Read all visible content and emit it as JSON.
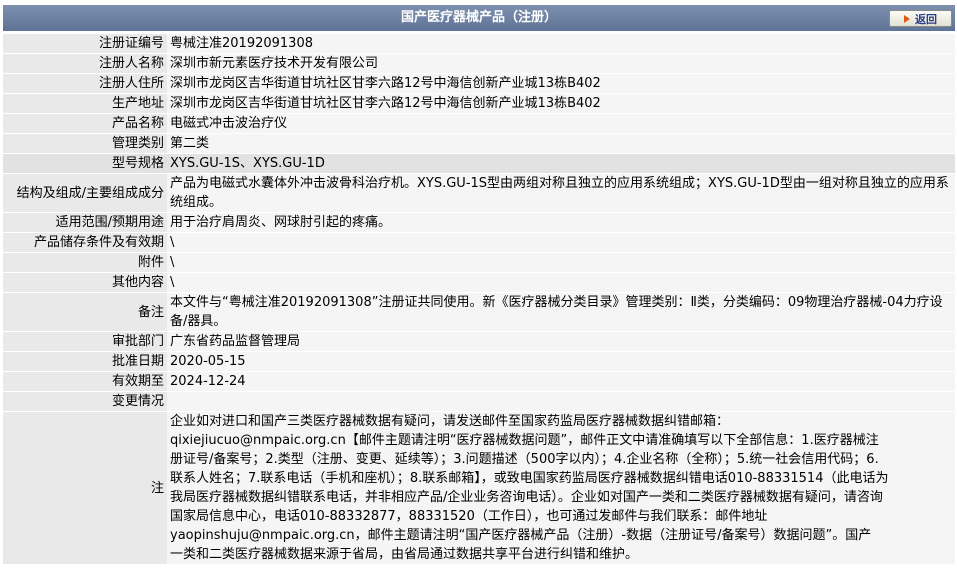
{
  "header": {
    "title": "国产医疗器械产品（注册）",
    "back_label": "返回"
  },
  "rows": [
    {
      "label": "注册证编号",
      "value": "粤械注准20192091308"
    },
    {
      "label": "注册人名称",
      "value": "深圳市新元素医疗技术开发有限公司"
    },
    {
      "label": "注册人住所",
      "value": "深圳市龙岗区吉华街道甘坑社区甘李六路12号中海信创新产业城13栋B402"
    },
    {
      "label": "生产地址",
      "value": "深圳市龙岗区吉华街道甘坑社区甘李六路12号中海信创新产业城13栋B402"
    },
    {
      "label": "产品名称",
      "value": "电磁式冲击波治疗仪"
    },
    {
      "label": "管理类别",
      "value": "第二类"
    },
    {
      "label": "型号规格",
      "value": "XYS.GU-1S、XYS.GU-1D"
    },
    {
      "label": "结构及组成/主要组成成分",
      "value": "产品为电磁式水囊体外冲击波骨科治疗机。XYS.GU-1S型由两组对称且独立的应用系统组成；XYS.GU-1D型由一组对称且独立的应用系统组成。"
    },
    {
      "label": "适用范围/预期用途",
      "value": "用于治疗肩周炎、网球肘引起的疼痛。"
    },
    {
      "label": "产品储存条件及有效期",
      "value": "\\"
    },
    {
      "label": "附件",
      "value": "\\"
    },
    {
      "label": "其他内容",
      "value": "\\"
    },
    {
      "label": "备注",
      "value": "本文件与“粤械注准20192091308”注册证共同使用。新《医疗器械分类目录》管理类别：Ⅱ类，分类编码：09物理治疗器械-04力疗设备/器具。"
    },
    {
      "label": "审批部门",
      "value": "广东省药品监督管理局"
    },
    {
      "label": "批准日期",
      "value": "2020-05-15"
    },
    {
      "label": "有效期至",
      "value": "2024-12-24"
    },
    {
      "label": "变更情况",
      "value": ""
    }
  ],
  "note": {
    "label": "注",
    "lines": [
      "企业如对进口和国产三类医疗器械数据有疑问，请发送邮件至国家药监局医疗器械数据纠错邮箱：",
      "qixiejiucuo@nmpaic.org.cn【邮件主题请注明“医疗器械数据问题”，邮件正文中请准确填写以下全部信息：1.医疗器械注",
      "册证号/备案号；2.类型（注册、变更、延续等）；3.问题描述（500字以内）；4.企业名称（全称）；5.统一社会信用代码；6.",
      "联系人姓名；7.联系电话（手机和座机）；8.联系邮箱】，或致电国家药监局医疗器械数据纠错电话010-88331514（此电话为",
      "我局医疗器械数据纠错联系电话，并非相应产品/企业业务咨询电话）。企业如对国产一类和二类医疗器械数据有疑问，请咨询",
      "国家局信息中心，电话010-88332877，88331520（工作日），也可通过发邮件与我们联系：邮件地址",
      "yaopinshuju@nmpaic.org.cn，邮件主题请注明“国产医疗器械产品（注册）-数据（注册证号/备案号）数据问题”。国产",
      "一类和二类医疗器械数据来源于省局，由省局通过数据共享平台进行纠错和维护。"
    ]
  }
}
